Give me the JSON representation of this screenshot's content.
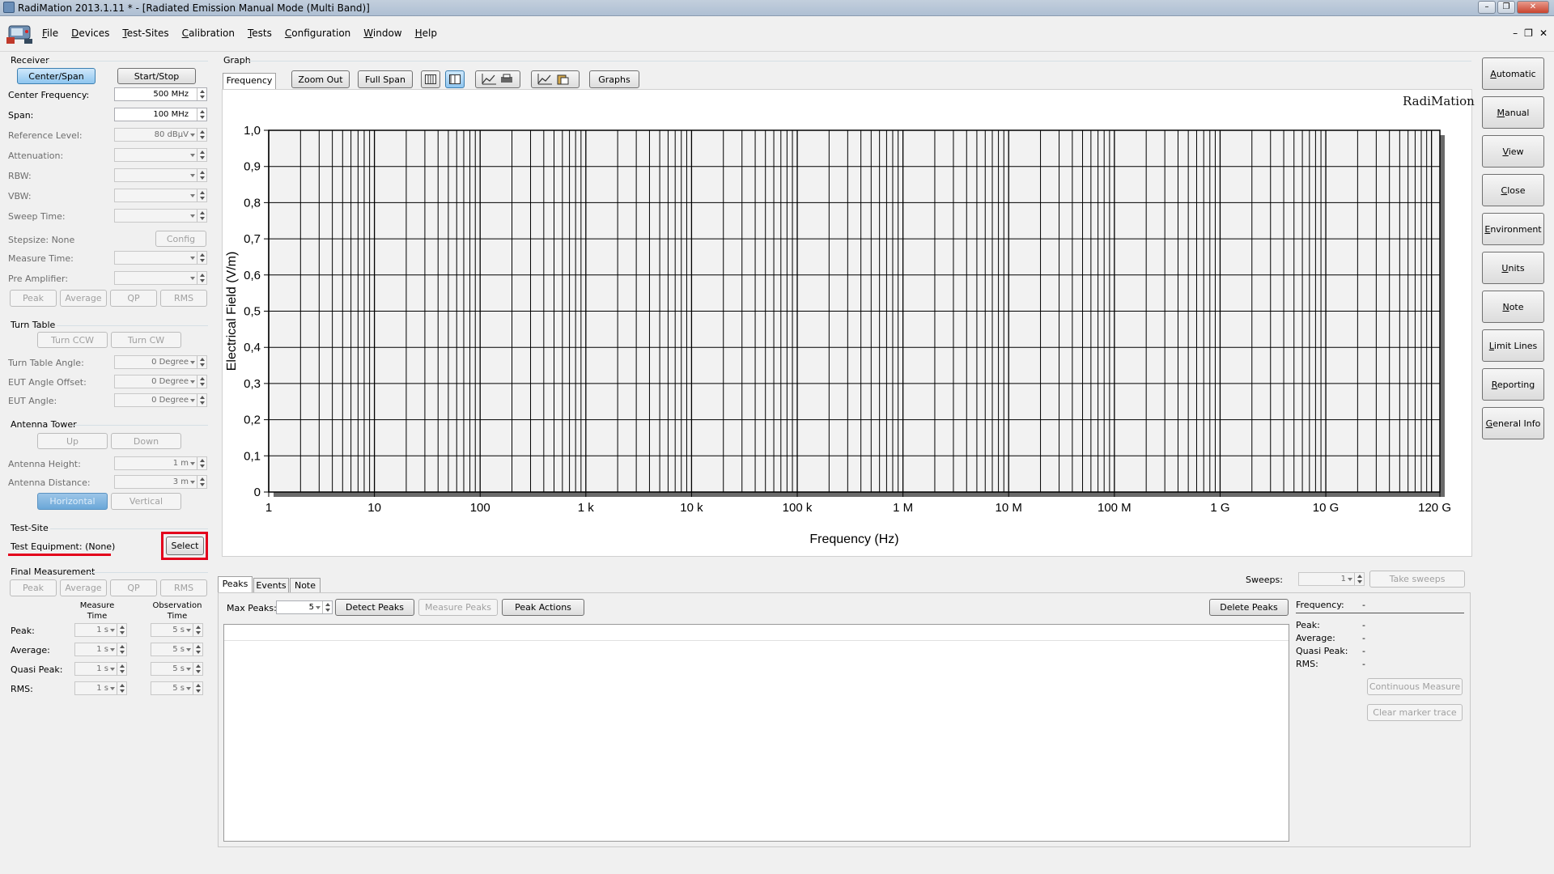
{
  "window": {
    "title": "RadiMation 2013.1.11 * - [Radiated Emission Manual Mode (Multi Band)]",
    "controls": [
      "–",
      "❐",
      "✕"
    ]
  },
  "menubar": {
    "items": [
      "File",
      "Devices",
      "Test-Sites",
      "Calibration",
      "Tests",
      "Configuration",
      "Window",
      "Help"
    ],
    "mdi_controls": [
      "–",
      "❐",
      "✕"
    ]
  },
  "receiver": {
    "title": "Receiver",
    "center_span": "Center/Span",
    "start_stop": "Start/Stop",
    "center_frequency_label": "Center Frequency:",
    "center_frequency": "500 MHz",
    "span_label": "Span:",
    "span": "100 MHz",
    "reference_level_label": "Reference Level:",
    "reference_level": "80 dBµV",
    "attenuation_label": "Attenuation:",
    "rbw_label": "RBW:",
    "vbw_label": "VBW:",
    "sweep_time_label": "Sweep Time:",
    "stepsize_label": "Stepsize: None",
    "config_button": "Config",
    "measure_time_label": "Measure Time:",
    "pre_amplifier_label": "Pre Amplifier:",
    "detectors": [
      "Peak",
      "Average",
      "QP",
      "RMS"
    ]
  },
  "turn_table": {
    "title": "Turn Table",
    "turn_ccw": "Turn CCW",
    "turn_cw": "Turn CW",
    "angle_label": "Turn Table Angle:",
    "angle": "0 Degree",
    "eut_offset_label": "EUT Angle Offset:",
    "eut_offset": "0 Degree",
    "eut_angle_label": "EUT Angle:",
    "eut_angle": "0 Degree"
  },
  "antenna_tower": {
    "title": "Antenna Tower",
    "up": "Up",
    "down": "Down",
    "height_label": "Antenna Height:",
    "height": "1 m",
    "distance_label": "Antenna Distance:",
    "distance": "3 m",
    "horizontal": "Horizontal",
    "vertical": "Vertical"
  },
  "test_site": {
    "title": "Test-Site",
    "equipment_label": "Test Equipment: (None)",
    "select_button": "Select"
  },
  "final_measurement": {
    "title": "Final Measurement",
    "detectors": [
      "Peak",
      "Average",
      "QP",
      "RMS"
    ],
    "measure_time_header": "Measure Time",
    "observation_time_header": "Observation Time",
    "rows": [
      {
        "label": "Peak:",
        "measure": "1 s",
        "observation": "5 s"
      },
      {
        "label": "Average:",
        "measure": "1 s",
        "observation": "5 s"
      },
      {
        "label": "Quasi Peak:",
        "measure": "1 s",
        "observation": "5 s"
      },
      {
        "label": "RMS:",
        "measure": "1 s",
        "observation": "5 s"
      }
    ]
  },
  "graph": {
    "group_title": "Graph",
    "tab": "Frequency",
    "zoom_out": "Zoom Out",
    "full_span": "Full Span",
    "graphs_button": "Graphs",
    "brand": "RadiMation"
  },
  "chart_data": {
    "type": "line",
    "xlabel": "Frequency (Hz)",
    "ylabel": "Electrical Field (V/m)",
    "x_scale": "log",
    "xlim": [
      1,
      120000000000
    ],
    "ylim": [
      0,
      1
    ],
    "x_ticks": [
      {
        "value": 1,
        "label": "1"
      },
      {
        "value": 10,
        "label": "10"
      },
      {
        "value": 100,
        "label": "100"
      },
      {
        "value": 1000,
        "label": "1 k"
      },
      {
        "value": 10000,
        "label": "10 k"
      },
      {
        "value": 100000,
        "label": "100 k"
      },
      {
        "value": 1000000,
        "label": "1 M"
      },
      {
        "value": 10000000,
        "label": "10 M"
      },
      {
        "value": 100000000,
        "label": "100 M"
      },
      {
        "value": 1000000000,
        "label": "1 G"
      },
      {
        "value": 10000000000,
        "label": "10 G"
      },
      {
        "value": 120000000000,
        "label": "120 G"
      }
    ],
    "y_ticks": [
      "0",
      "0,1",
      "0,2",
      "0,3",
      "0,4",
      "0,5",
      "0,6",
      "0,7",
      "0,8",
      "0,9",
      "1,0"
    ],
    "grid": true,
    "series": []
  },
  "peaks_panel": {
    "tabs": [
      "Peaks",
      "Events",
      "Note"
    ],
    "sweeps_label": "Sweeps:",
    "sweeps": "1",
    "take_sweeps": "Take sweeps",
    "max_peaks_label": "Max Peaks:",
    "max_peaks": "5",
    "detect_peaks": "Detect Peaks",
    "measure_peaks": "Measure Peaks",
    "peak_actions": "Peak Actions",
    "delete_peaks": "Delete Peaks",
    "info": [
      {
        "label": "Frequency:",
        "value": "-"
      },
      {
        "label": "Peak:",
        "value": "-"
      },
      {
        "label": "Average:",
        "value": "-"
      },
      {
        "label": "Quasi Peak:",
        "value": "-"
      },
      {
        "label": "RMS:",
        "value": "-"
      }
    ],
    "continuous_measure": "Continuous Measure",
    "clear_marker_trace": "Clear marker trace"
  },
  "right_buttons": [
    "Automatic",
    "Manual",
    "View",
    "Close",
    "Environment",
    "Units",
    "Note",
    "Limit Lines",
    "Reporting",
    "General Info"
  ],
  "colors": {
    "highlight": "#e3001b",
    "view_button": "#ff0000",
    "selected_button": "#8ec5ef"
  }
}
